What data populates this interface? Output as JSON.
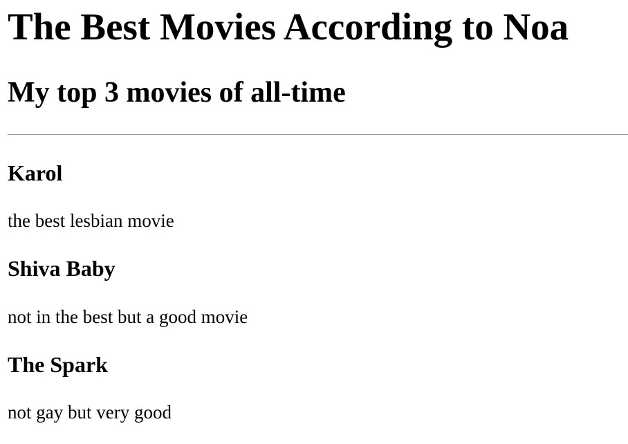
{
  "header": {
    "title": "The Best Movies According to Noa",
    "subtitle": "My top 3 movies of all-time"
  },
  "movies": [
    {
      "title": "Karol",
      "description": "the best lesbian movie"
    },
    {
      "title": "Shiva Baby",
      "description": "not in the best but a good movie"
    },
    {
      "title": "The Spark",
      "description": "not gay but very good"
    }
  ]
}
